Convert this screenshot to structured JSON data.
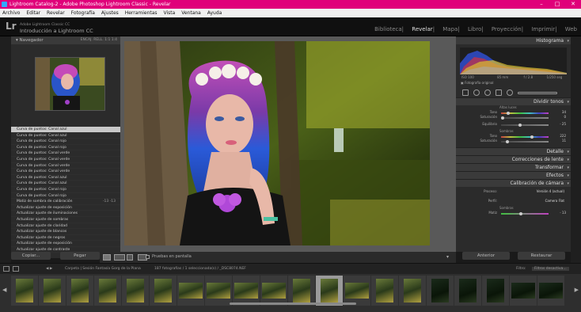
{
  "window": {
    "title": "Lightroom Catalog-2 - Adobe Photoshop Lightroom Classic - Revelar"
  },
  "menu": [
    "Archivo",
    "Editar",
    "Revelar",
    "Fotografía",
    "Ajustes",
    "Herramientas",
    "Vista",
    "Ventana",
    "Ayuda"
  ],
  "identity": {
    "logo": "Lr",
    "subtitle": "Adobe Lightroom Classic CC",
    "title": "Introducción a Lightroom CC"
  },
  "modules": [
    "Biblioteca",
    "Revelar",
    "Mapa",
    "Libro",
    "Proyección",
    "Imprimir",
    "Web"
  ],
  "active_module": "Revelar",
  "navigator": {
    "label": "Navegador",
    "options": "ENCAJ.   RELL.   1:1   1:4"
  },
  "history": [
    {
      "label": "Curva de puntos: Canal azul",
      "selected": true
    },
    {
      "label": "Curva de puntos: Canal azul"
    },
    {
      "label": "Curva de puntos: Canal rojo"
    },
    {
      "label": "Curva de puntos: Canal rojo"
    },
    {
      "label": "Curva de puntos: Canal verde"
    },
    {
      "label": "Curva de puntos: Canal verde"
    },
    {
      "label": "Curva de puntos: Canal verde"
    },
    {
      "label": "Curva de puntos: Canal verde"
    },
    {
      "label": "Curva de puntos: Canal azul"
    },
    {
      "label": "Curva de puntos: Canal azul"
    },
    {
      "label": "Curva de puntos: Canal rojo"
    },
    {
      "label": "Curva de puntos: Canal rojo"
    },
    {
      "label": "Matiz de sombra de calibración",
      "value": "-13   -13"
    },
    {
      "label": "Actualizar ajuste de exposición"
    },
    {
      "label": "Actualizar ajuste de iluminaciones"
    },
    {
      "label": "Actualizar ajuste de sombras"
    },
    {
      "label": "Actualizar ajuste de claridad"
    },
    {
      "label": "Actualizar ajuste de blancos"
    },
    {
      "label": "Actualizar ajuste de negros"
    },
    {
      "label": "Actualizar ajuste de exposición"
    },
    {
      "label": "Actualizar ajuste de contraste"
    }
  ],
  "left_buttons": {
    "copy": "Copiar...",
    "paste": "Pegar"
  },
  "toolbar": {
    "soft_proof": "Pruebas en pantalla"
  },
  "right": {
    "histogram_label": "Histograma",
    "histo_meta": [
      "ISO 100",
      "85 mm",
      "f / 2.8",
      "1/250 seg"
    ],
    "original_photo": "Fotografía original",
    "split_toning": "Dividir tonos",
    "highlights_label": "Altas luces",
    "shadows_label": "Sombras",
    "sliders_high": [
      {
        "label": "Tono",
        "value": "34"
      },
      {
        "label": "Saturación",
        "value": "0"
      }
    ],
    "balance": {
      "label": "Equilibrio",
      "value": "- 25"
    },
    "sliders_shadow": [
      {
        "label": "Tono",
        "value": "222"
      },
      {
        "label": "Saturación",
        "value": "11"
      }
    ],
    "sections": [
      "Detalle",
      "Correcciones de lente",
      "Transformar",
      "Efectos",
      "Calibración de cámara"
    ],
    "calib_process": {
      "label": "Proceso:",
      "value": "Versión 4 (actual)"
    },
    "calib_profile": {
      "label": "Perfil:",
      "value": "Camera Flat"
    },
    "calib_shadows": "Sombras",
    "calib_tint": {
      "label": "Matiz",
      "value": "- 13"
    }
  },
  "right_buttons": {
    "previous": "Anterior",
    "reset": "Restaurar"
  },
  "filmbar": {
    "info": "Carpeta | Sesión Fantasía Gorg de la Plana",
    "count": "187 fotografías / 1 seleccionada(s) / _DSC8074.NEF",
    "filter_label": "Filtro:",
    "filter_value": "Filtros desactiva..."
  }
}
